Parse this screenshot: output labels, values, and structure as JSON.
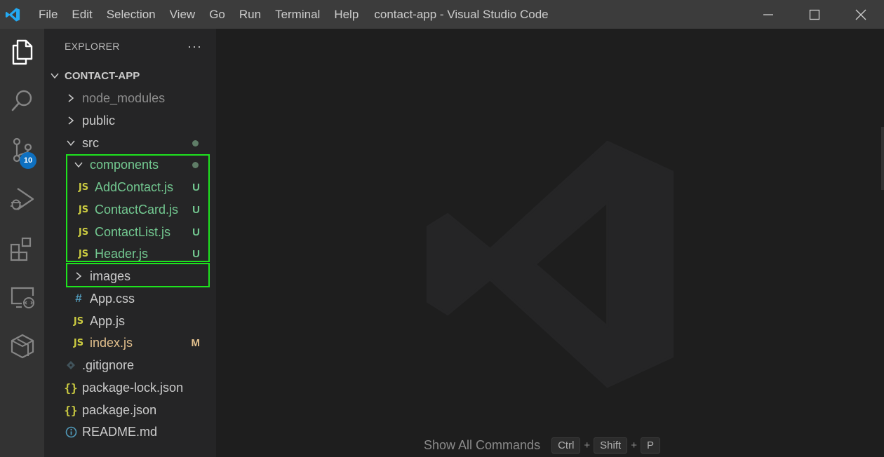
{
  "window": {
    "title": "contact-app - Visual Studio Code"
  },
  "menu": [
    "File",
    "Edit",
    "Selection",
    "View",
    "Go",
    "Run",
    "Terminal",
    "Help"
  ],
  "activity_bar": {
    "items": [
      "explorer-icon",
      "search-icon",
      "source-control-icon",
      "run-debug-icon",
      "extensions-icon",
      "remote-explorer-icon",
      "docker-icon"
    ],
    "source_control_badge": "10"
  },
  "explorer": {
    "title": "EXPLORER",
    "more": "···",
    "root": "CONTACT-APP",
    "tree": [
      {
        "label": "node_modules",
        "kind": "folder-collapsed",
        "depth": 1,
        "style": "dim"
      },
      {
        "label": "public",
        "kind": "folder-collapsed",
        "depth": 1,
        "style": "normal"
      },
      {
        "label": "src",
        "kind": "folder-expanded",
        "depth": 1,
        "style": "normal",
        "dot": true
      },
      {
        "label": "components",
        "kind": "folder-expanded",
        "depth": 2,
        "style": "green",
        "dot": true
      },
      {
        "label": "AddContact.js",
        "kind": "js",
        "depth": 3,
        "style": "green",
        "status": "U"
      },
      {
        "label": "ContactCard.js",
        "kind": "js",
        "depth": 3,
        "style": "green",
        "status": "U"
      },
      {
        "label": "ContactList.js",
        "kind": "js",
        "depth": 3,
        "style": "green",
        "status": "U"
      },
      {
        "label": "Header.js",
        "kind": "js",
        "depth": 3,
        "style": "green",
        "status": "U"
      },
      {
        "label": "images",
        "kind": "folder-collapsed",
        "depth": 2,
        "style": "normal"
      },
      {
        "label": "App.css",
        "kind": "css",
        "depth": 2,
        "style": "normal"
      },
      {
        "label": "App.js",
        "kind": "js",
        "depth": 2,
        "style": "normal"
      },
      {
        "label": "index.js",
        "kind": "js",
        "depth": 2,
        "style": "mod",
        "status": "M"
      },
      {
        "label": ".gitignore",
        "kind": "git",
        "depth": 1,
        "style": "normal"
      },
      {
        "label": "package-lock.json",
        "kind": "json",
        "depth": 1,
        "style": "normal"
      },
      {
        "label": "package.json",
        "kind": "json",
        "depth": 1,
        "style": "normal"
      },
      {
        "label": "README.md",
        "kind": "info",
        "depth": 1,
        "style": "normal"
      }
    ]
  },
  "editor": {
    "hint_label": "Show All Commands",
    "keys": [
      "Ctrl",
      "Shift",
      "P"
    ],
    "plus": "+"
  },
  "colors": {
    "titlebar": "#3c3c3c",
    "activitybar": "#333333",
    "sidebar": "#252526",
    "editor": "#1e1e1e",
    "untracked": "#73c991",
    "modified": "#e2c08d",
    "highlight": "#1ee31e",
    "badge": "#0e70c0"
  }
}
